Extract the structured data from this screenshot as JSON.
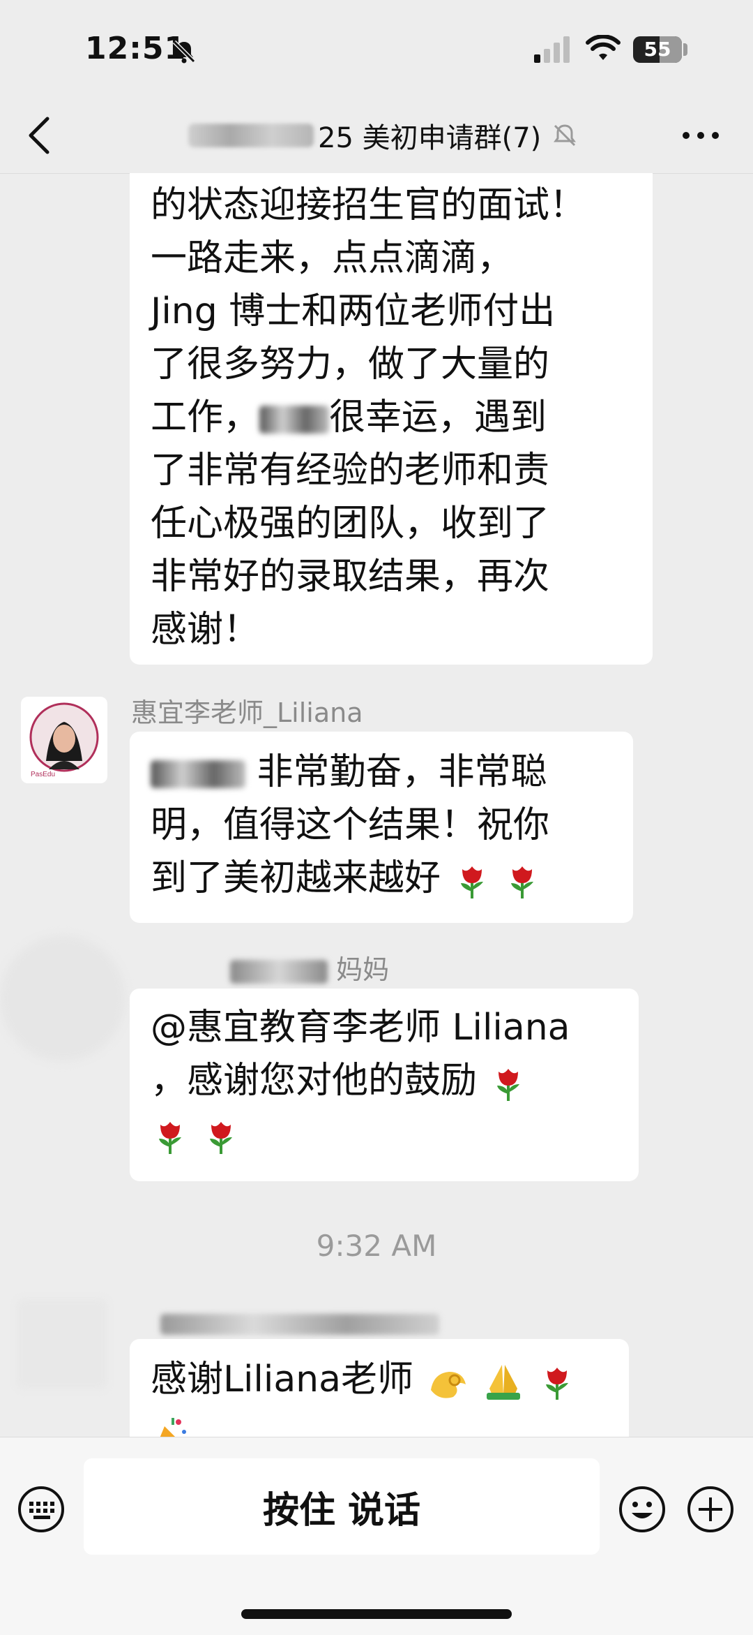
{
  "status_bar": {
    "time": "12:51",
    "battery": "55"
  },
  "header": {
    "title": "25 美初申请群(7)"
  },
  "messages": [
    {
      "type": "text",
      "lines": [
        "的状态迎接招生官的面试！",
        "一路走来，点点滴滴，",
        "Jing 博士和两位老师付出",
        "了很多努力，做了大量的",
        "工作，",
        "很幸运，遇到",
        "了非常有经验的老师和责",
        "任心极强的团队，收到了",
        "非常好的录取结果，再次",
        "感谢！"
      ]
    },
    {
      "type": "text",
      "sender": "惠宜李老师_Liliana",
      "lines": [
        "非常勤奋，非常聪",
        "明，值得这个结果！祝你",
        "到了美初越来越好"
      ]
    },
    {
      "type": "text",
      "sender": "妈妈",
      "lines": [
        "@惠宜教育李老师 Liliana",
        "，感谢您对他的鼓励"
      ]
    },
    {
      "type": "timestamp",
      "text": "9:32 AM"
    },
    {
      "type": "text",
      "lines": [
        "感谢Liliana老师"
      ]
    }
  ],
  "input_bar": {
    "hold_to_talk": "按住 说话"
  },
  "icons": {
    "mute": "bell-slash-icon",
    "signal": "signal-icon",
    "wifi": "wifi-icon",
    "back": "chevron-left-icon",
    "more": "more-icon",
    "keyboard": "keyboard-icon",
    "emoji": "smiley-icon",
    "plus": "plus-circle-icon"
  },
  "colors": {
    "background": "#ededed",
    "bubble": "#ffffff",
    "rose": "#d0191e",
    "stem": "#3a9a35"
  }
}
